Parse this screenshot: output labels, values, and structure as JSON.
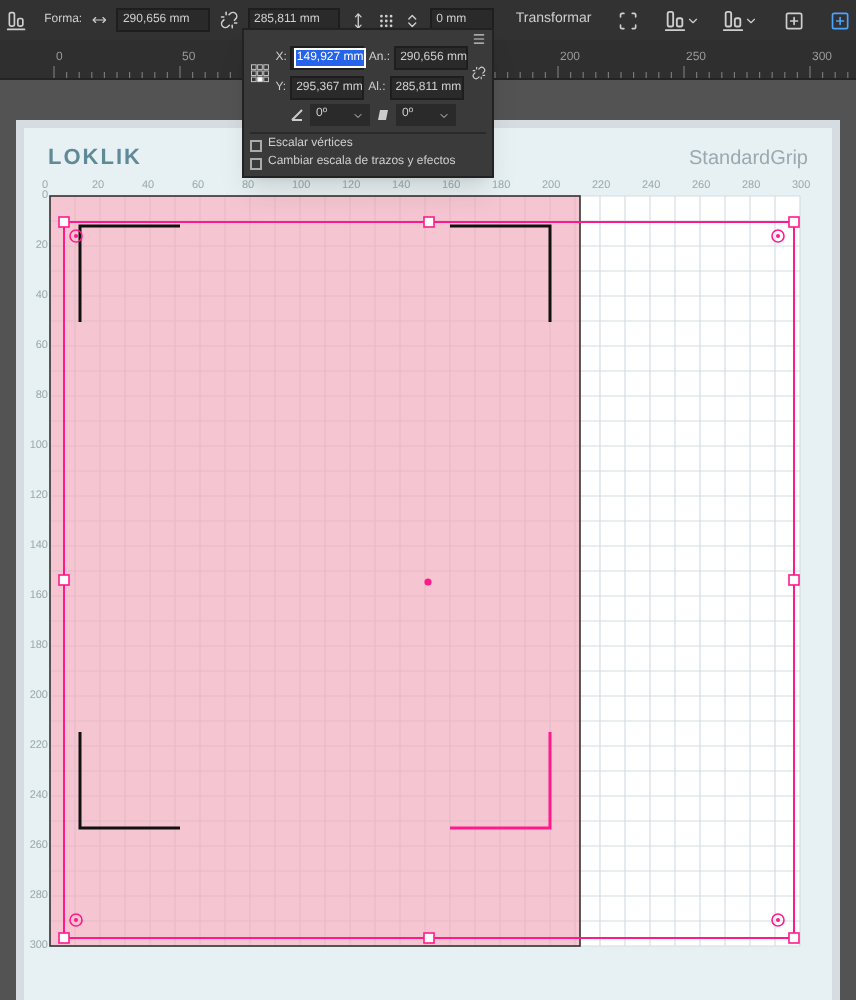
{
  "toolbar": {
    "shape_label": "Forma:",
    "width": "290,656 mm",
    "height": "285,811 mm",
    "corner": "0 mm",
    "transform_label": "Transformar"
  },
  "ruler": {
    "labels": [
      "0",
      "50",
      "200",
      "250",
      "300"
    ]
  },
  "transform_popup": {
    "x_label": "X:",
    "x": "149,927 mm",
    "width_label": "An.:",
    "width": "290,656 mm",
    "y_label": "Y:",
    "y": "295,367 mm",
    "height_label": "Al.:",
    "height": "285,811 mm",
    "angle": "0º",
    "shear": "0º",
    "options": [
      {
        "label": "Escalar vértices",
        "checked": false
      },
      {
        "label": "Cambiar escala de trazos y efectos",
        "checked": false
      }
    ]
  },
  "artboard": {
    "brand": "LOKLIK",
    "product": "StandardGrip",
    "x_axis": [
      "0",
      "20",
      "40",
      "60",
      "80",
      "100",
      "120",
      "140",
      "160",
      "180",
      "200",
      "220",
      "240",
      "260",
      "280",
      "300"
    ],
    "y_axis": [
      "0",
      "20",
      "40",
      "60",
      "80",
      "100",
      "120",
      "140",
      "160",
      "180",
      "200",
      "220",
      "240",
      "260",
      "280",
      "300"
    ]
  }
}
